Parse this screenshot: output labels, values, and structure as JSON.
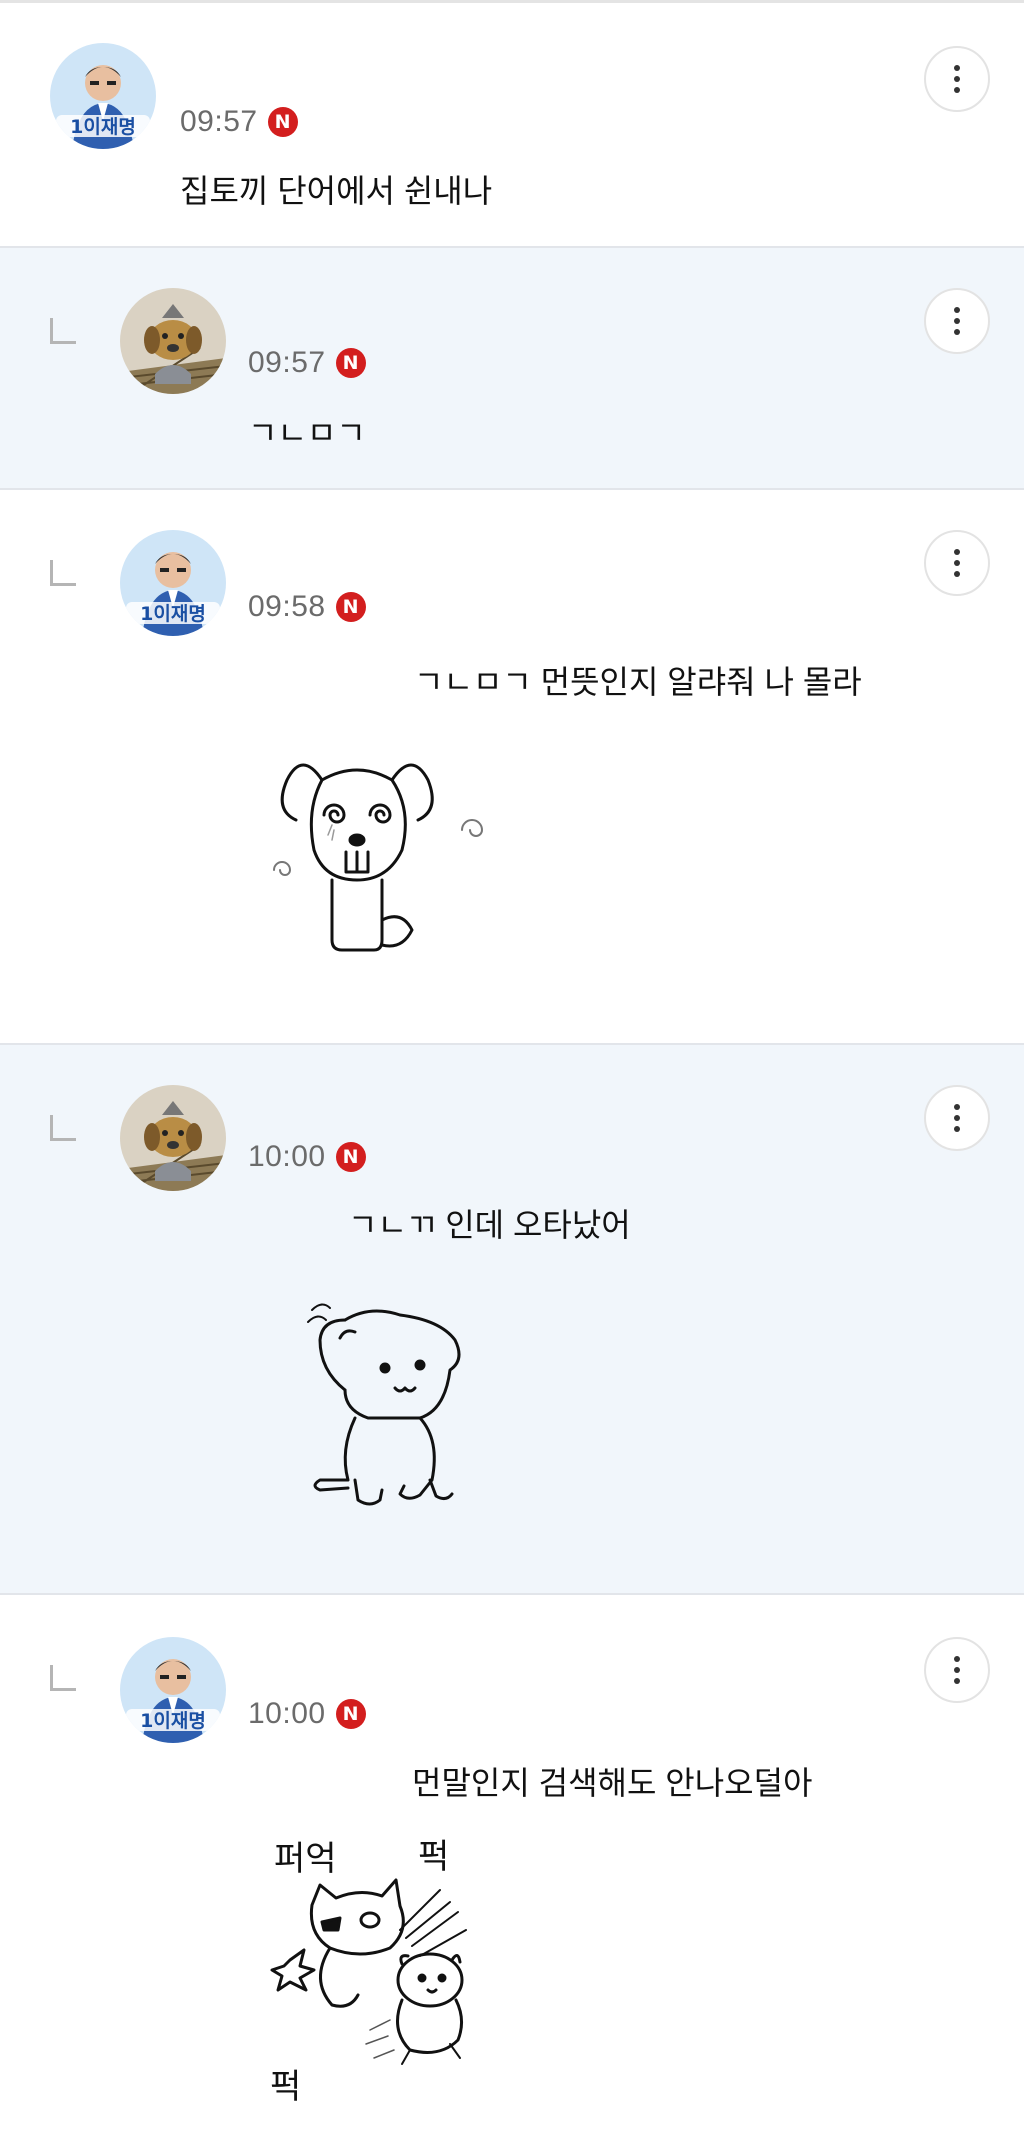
{
  "comments": [
    {
      "type": "top",
      "avatar": "politician-avatar",
      "avatar_label": "1이재명",
      "time": "09:57",
      "badge": "N",
      "text": "집토끼 단어에서 쉰내나"
    },
    {
      "type": "reply",
      "avatar": "dog-doll-avatar",
      "time": "09:57",
      "badge": "N",
      "text": "ㄱㄴㅁㄱ"
    },
    {
      "type": "reply",
      "avatar": "politician-avatar",
      "avatar_label": "1이재명",
      "time": "09:58",
      "badge": "N",
      "text": "ㄱㄴㅁㄱ 먼뜻인지 알랴줘 나 몰라",
      "sticker": "dizzy-dog-sticker"
    },
    {
      "type": "reply",
      "avatar": "dog-doll-avatar",
      "time": "10:00",
      "badge": "N",
      "text": "ㄱㄴㄲ 인데 오타났어",
      "sticker": "scratching-dog-sticker"
    },
    {
      "type": "reply",
      "avatar": "politician-avatar",
      "avatar_label": "1이재명",
      "time": "10:00",
      "badge": "N",
      "text": "먼말인지 검색해도 안나오덜아",
      "sticker": "cat-hitting-hamster-sticker",
      "sticker_text": [
        "퍼억",
        "퍽",
        "퍽"
      ]
    }
  ],
  "icons": {
    "more": "more-vertical-icon",
    "reply": "reply-arrow-icon"
  },
  "colors": {
    "reply_bg": "#f1f6fb",
    "badge": "#d31e1e",
    "time": "#6b6b6b"
  }
}
